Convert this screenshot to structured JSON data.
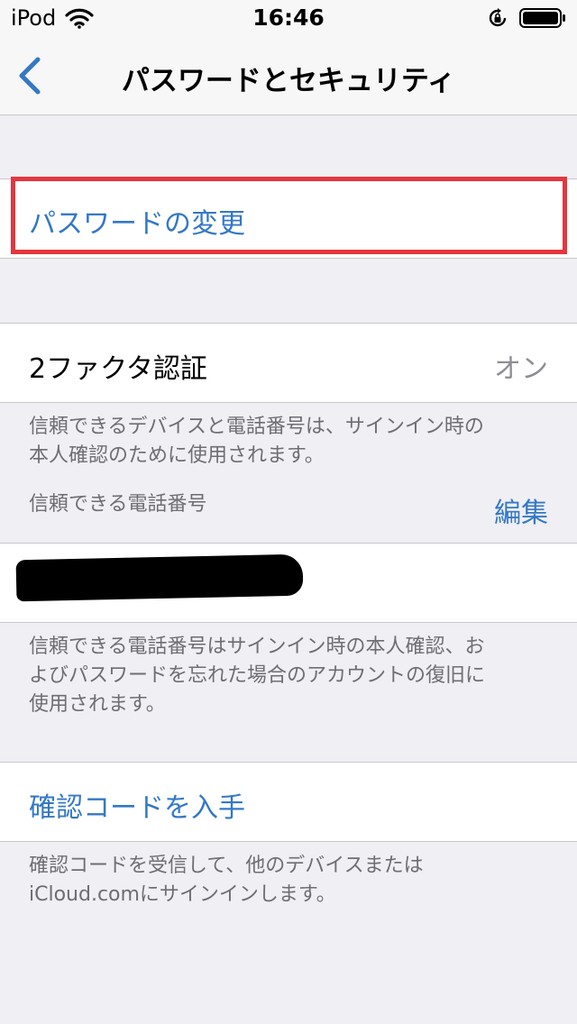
{
  "status_bar": {
    "carrier": "iPod",
    "time": "16:46"
  },
  "nav": {
    "title": "パスワードとセキュリティ"
  },
  "change_password": {
    "label": "パスワードの変更"
  },
  "two_factor": {
    "label": "2ファクタ認証",
    "value": "オン",
    "description_line1": "信頼できるデバイスと電話番号は、サインイン時の",
    "description_line2": "本人確認のために使用されます。"
  },
  "trusted_numbers": {
    "header": "信頼できる電話番号",
    "edit_label": "編集",
    "description_line1": "信頼できる電話番号はサインイン時の本人確認、お",
    "description_line2": "よびパスワードを忘れた場合のアカウントの復旧に",
    "description_line3": "使用されます。"
  },
  "verification_code": {
    "label": "確認コードを入手",
    "description_line1": "確認コードを受信して、他のデバイスまたは",
    "description_line2": "iCloud.comにサインインします。"
  },
  "colors": {
    "accent": "#3478c6",
    "highlight": "#e5363e",
    "background": "#efeff4"
  },
  "icons": [
    "wifi-icon",
    "lock-rotation-icon",
    "battery-icon",
    "chevron-left-icon"
  ]
}
